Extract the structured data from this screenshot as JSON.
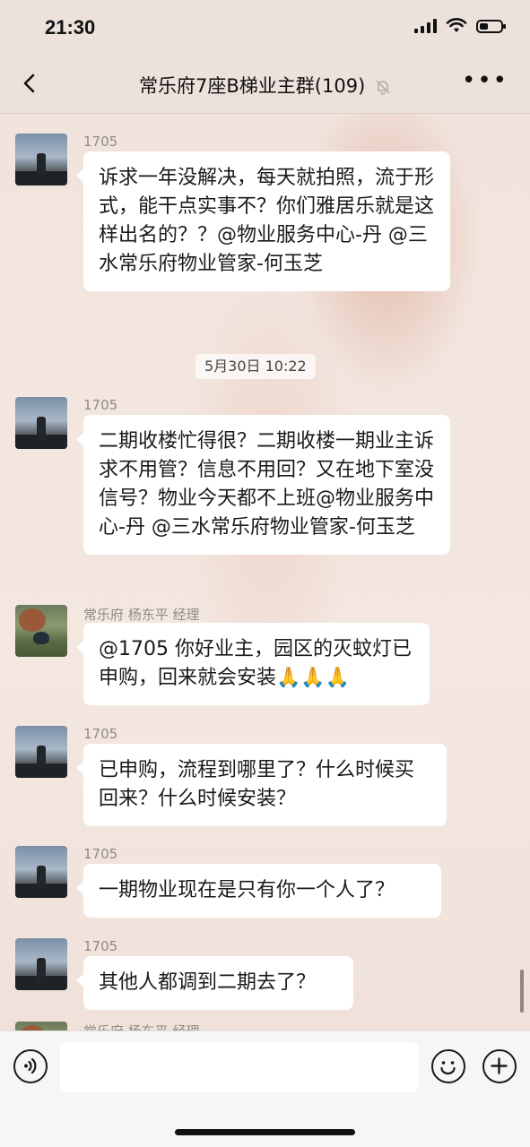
{
  "status": {
    "time": "21:30"
  },
  "header": {
    "title": "常乐府7座B梯业主群(109)"
  },
  "messages": [
    {
      "sender": "1705",
      "text": "诉求一年没解决，每天就拍照，流于形式，能干点实事不？你们雅居乐就是这样出名的？？@物业服务中心-丹 @三水常乐府物业管家-何玉芝"
    },
    {
      "sender": "1705",
      "text": "二期收楼忙得很？二期收楼一期业主诉求不用管？信息不用回？又在地下室没信号？物业今天都不上班@物业服务中心-丹 @三水常乐府物业管家-何玉芝"
    },
    {
      "sender": "常乐府 杨东平 经理",
      "text": "@1705 你好业主，园区的灭蚊灯已申购，回来就会安装🙏🙏🙏"
    },
    {
      "sender": "1705",
      "text": "已申购，流程到哪里了？什么时候买回来？什么时候安装？"
    },
    {
      "sender": "1705",
      "text": "一期物业现在是只有你一个人了？"
    },
    {
      "sender": "1705",
      "text": "其他人都调到二期去了？"
    }
  ],
  "timestamp": "5月30日 10:22",
  "cut_sender": "常乐府 杨东平 经理",
  "icons": {
    "back": "back-chevron-icon",
    "mute": "bell-off-icon",
    "more": "more-dots-icon",
    "voice": "voice-icon",
    "emoji": "emoji-icon",
    "plus": "plus-icon"
  }
}
